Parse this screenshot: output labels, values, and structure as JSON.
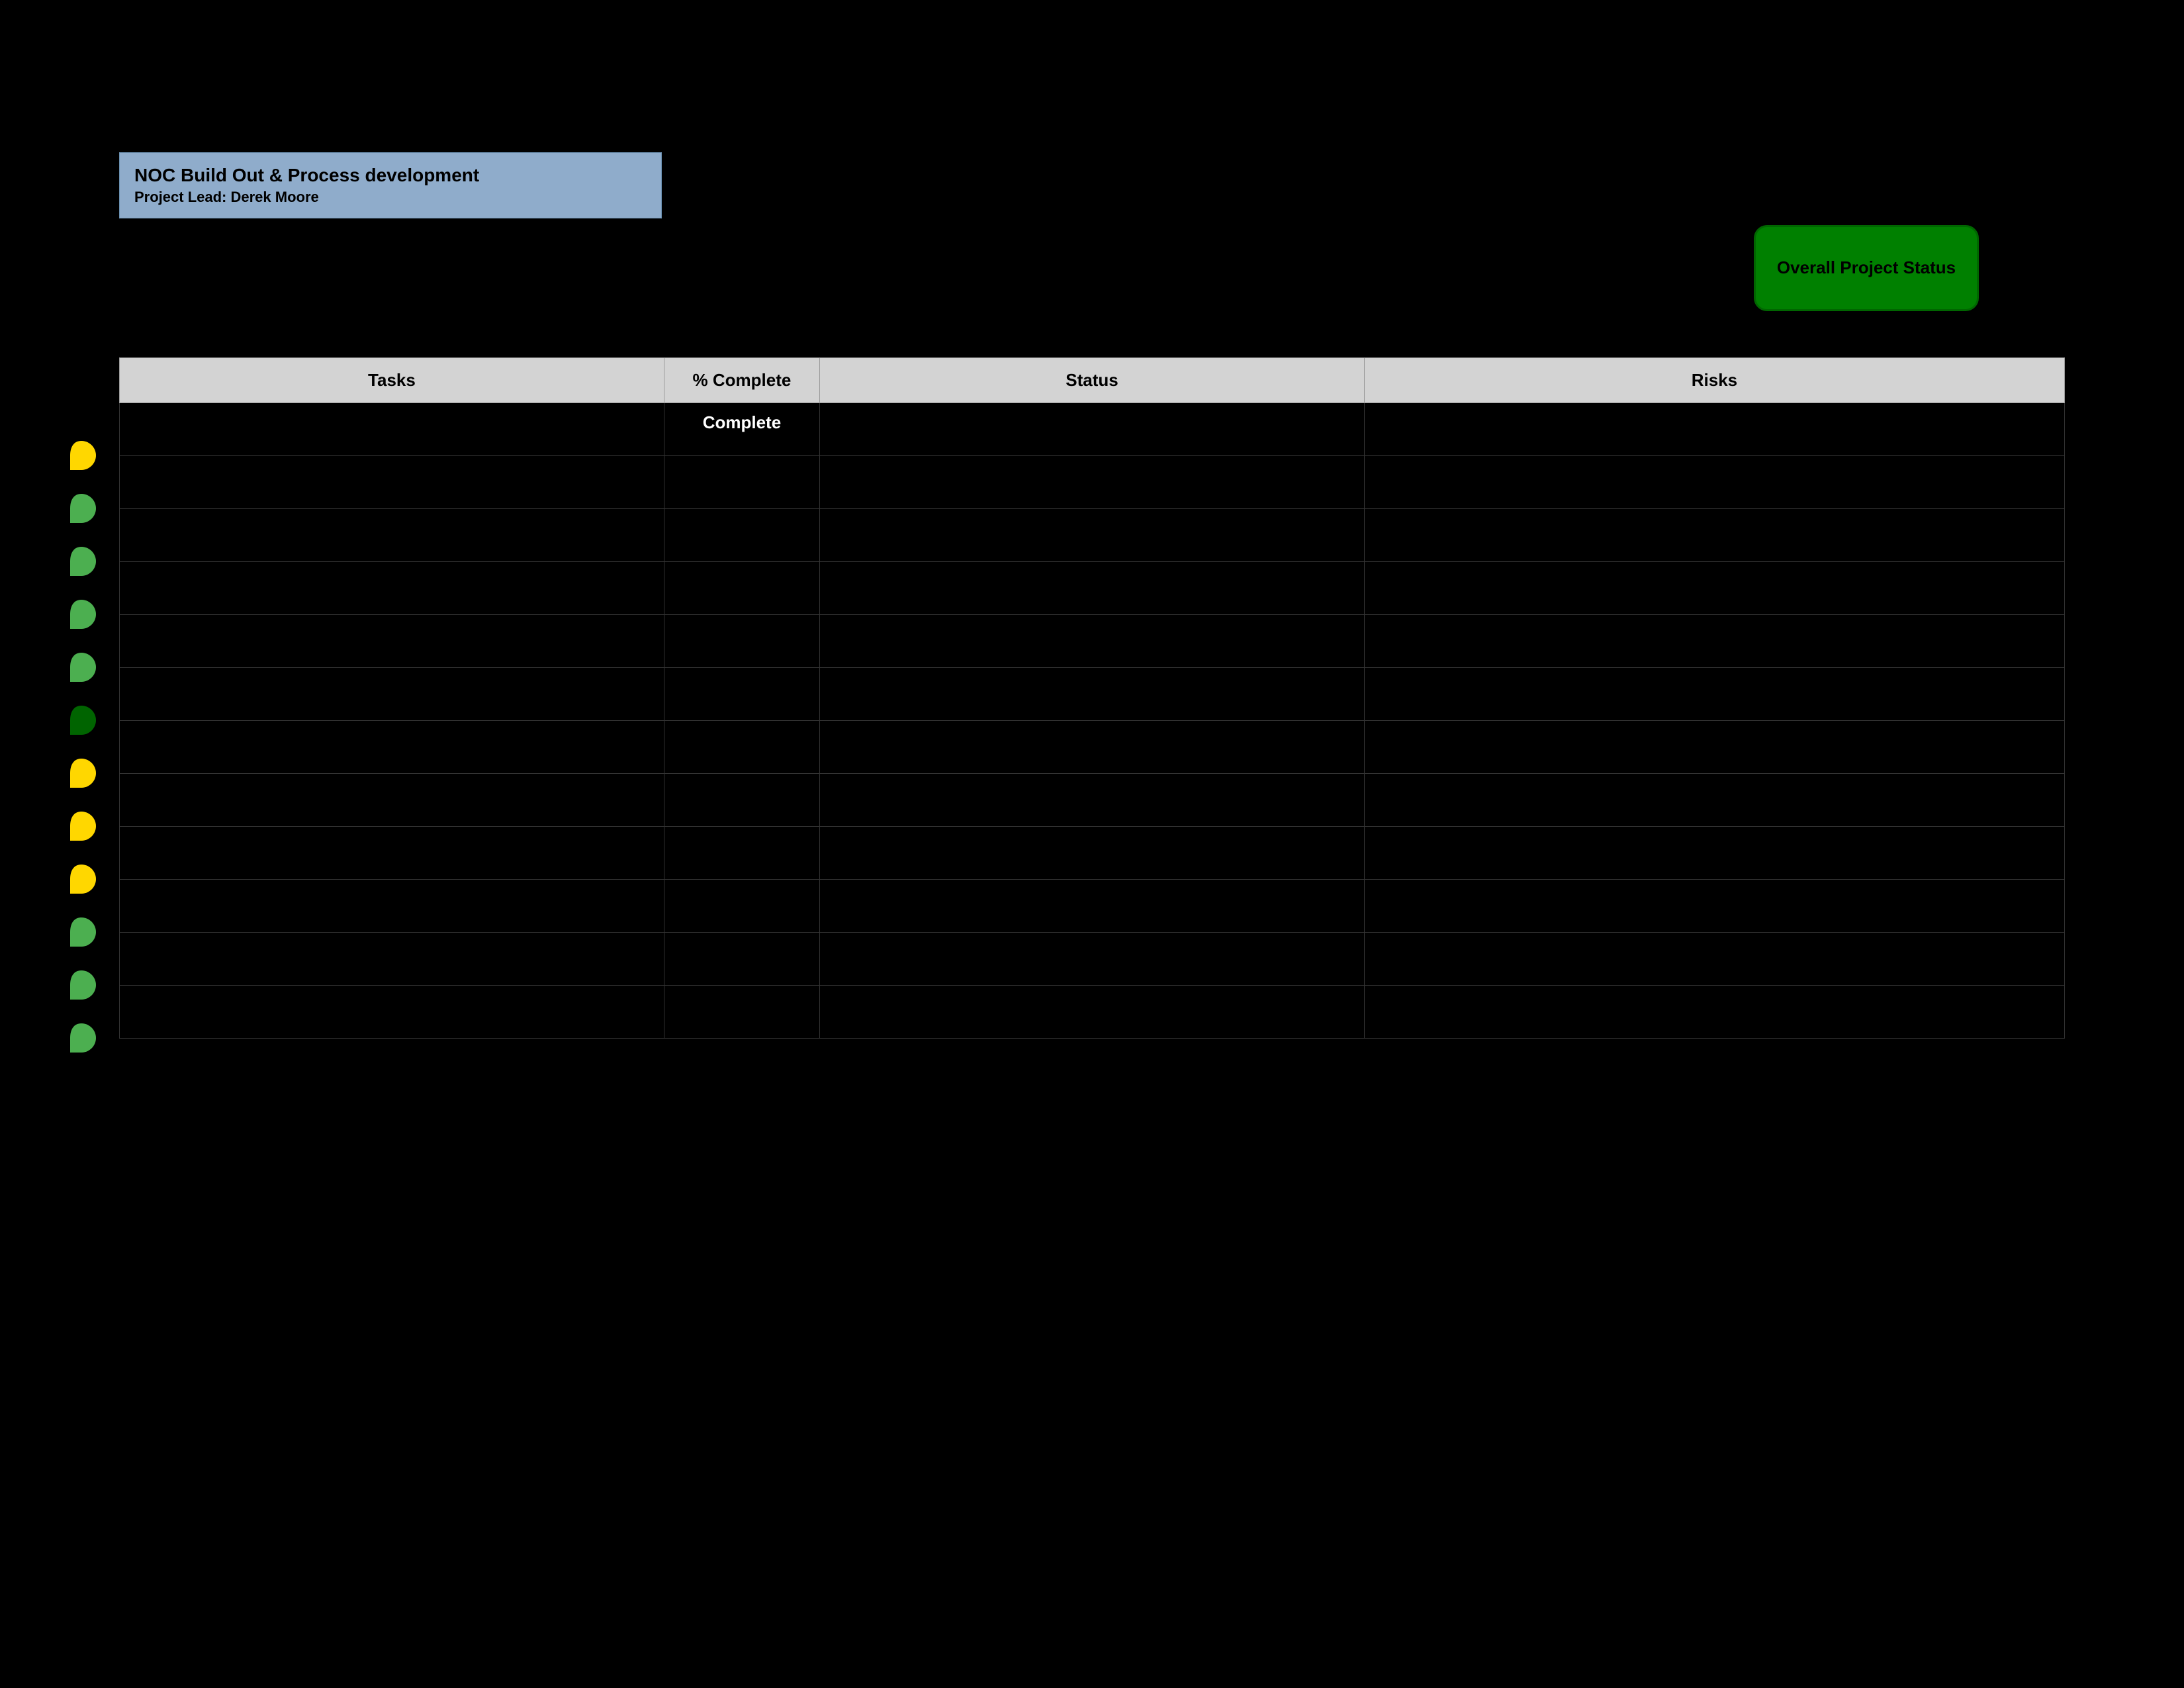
{
  "project": {
    "title": "NOC Build Out & Process development",
    "lead_label": "Project Lead:",
    "lead_name": "Derek Moore"
  },
  "overall_status": {
    "label": "Overall Project Status",
    "color": "#008000"
  },
  "table": {
    "headers": {
      "tasks": "Tasks",
      "complete": "% Complete",
      "status": "Status",
      "risks": "Risks"
    }
  },
  "complete_label": "Complete",
  "indicators": [
    {
      "color": "yellow",
      "type": "leaf"
    },
    {
      "color": "light-green",
      "type": "leaf"
    },
    {
      "color": "light-green",
      "type": "leaf"
    },
    {
      "color": "light-green",
      "type": "leaf"
    },
    {
      "color": "light-green",
      "type": "leaf"
    },
    {
      "color": "dark-green",
      "type": "leaf"
    },
    {
      "color": "yellow",
      "type": "leaf"
    },
    {
      "color": "yellow",
      "type": "leaf"
    },
    {
      "color": "yellow",
      "type": "leaf"
    },
    {
      "color": "light-green",
      "type": "leaf"
    },
    {
      "color": "light-green",
      "type": "leaf"
    },
    {
      "color": "light-green",
      "type": "leaf"
    }
  ]
}
